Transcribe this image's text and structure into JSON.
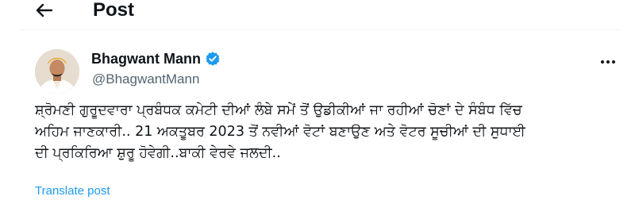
{
  "header": {
    "back_icon": "arrow-left-icon",
    "title": "Post"
  },
  "author": {
    "name": "Bhagwant Mann",
    "handle": "@BhagwantMann",
    "verified_icon": "verified-badge-icon",
    "verified_color": "#1d9bf0"
  },
  "menu": {
    "more_icon": "more-horizontal-icon"
  },
  "post": {
    "lines": [
      "ਸ਼੍ਰੋਮਣੀ ਗੁਰੂਦਵਾਰਾ ਪ੍ਰਬੰਧਕ ਕਮੇਟੀ ਦੀਆਂ ਲੰਬੇ ਸਮੇਂ ਤੋਂ ਉਡੀਕੀਆਂ ਜਾ ਰਹੀਆਂ ਚੋਣਾਂ ਦੇ ਸੰਬੰਧ ਵਿੱਚ",
      "ਅਹਿਮ ਜਾਣਕਾਰੀ.. 21 ਅਕਤੂਬਰ 2023 ਤੋਂ ਨਵੀਆਂ ਵੋਟਾਂ ਬਣਾਉਣ ਅਤੇ ਵੋਟਰ ਸੂਚੀਆਂ ਦੀ ਸੁਧਾਈ",
      "ਦੀ ਪ੍ਰਕਿਰਿਆ ਸ਼ੁਰੂ ਹੋਵੇਗੀ..ਬਾਕੀ ਵੇਰਵੇ ਜਲਦੀ.."
    ],
    "translate_label": "Translate post"
  },
  "colors": {
    "text_primary": "#0f1419",
    "text_secondary": "#536471",
    "link": "#1d9bf0",
    "divider": "#eff3f4"
  }
}
